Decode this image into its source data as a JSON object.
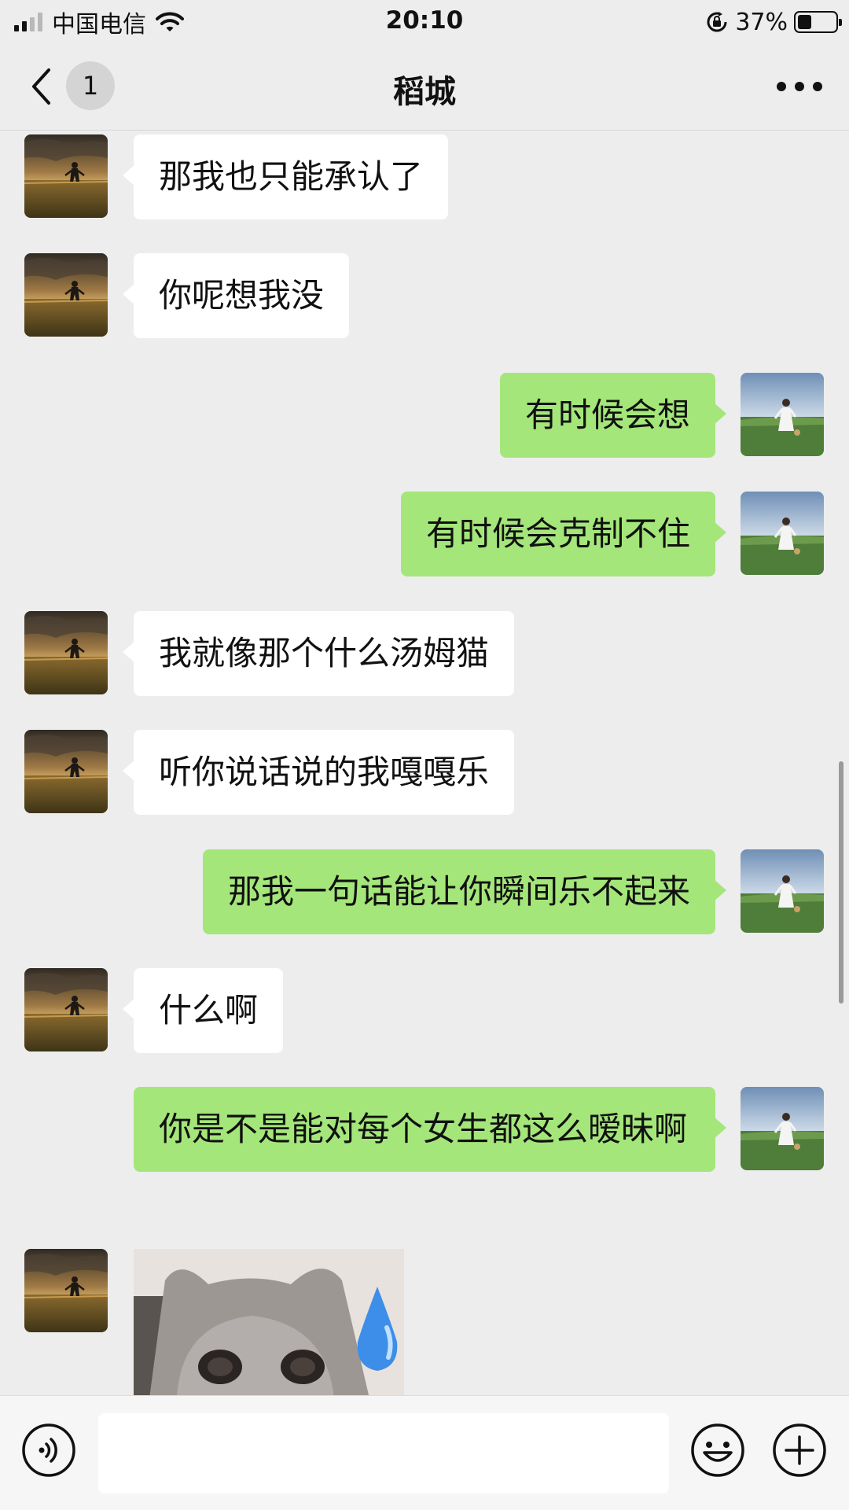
{
  "status_bar": {
    "carrier": "中国电信",
    "time": "20:10",
    "battery_percent_text": "37%",
    "battery_level": 0.37
  },
  "nav": {
    "unread_count": "1",
    "title": "稻城"
  },
  "messages": [
    {
      "side": "in",
      "text": "那我也只能承认了"
    },
    {
      "side": "in",
      "text": "你呢想我没"
    },
    {
      "side": "out",
      "text": "有时候会想"
    },
    {
      "side": "out",
      "text": "有时候会克制不住"
    },
    {
      "side": "in",
      "text": "我就像那个什么汤姆猫"
    },
    {
      "side": "in",
      "text": "听你说话说的我嘎嘎乐"
    },
    {
      "side": "out",
      "text": "那我一句话能让你瞬间乐不起来"
    },
    {
      "side": "in",
      "text": "什么啊"
    },
    {
      "side": "out",
      "text": "你是不是能对每个女生都这么暧昧啊"
    },
    {
      "side": "in",
      "type": "sticker",
      "sticker": "crying-cat-sticker"
    }
  ],
  "input": {
    "value": "",
    "placeholder": ""
  },
  "colors": {
    "background": "#ededed",
    "outgoing_bubble": "#a4e67a",
    "incoming_bubble": "#ffffff"
  }
}
